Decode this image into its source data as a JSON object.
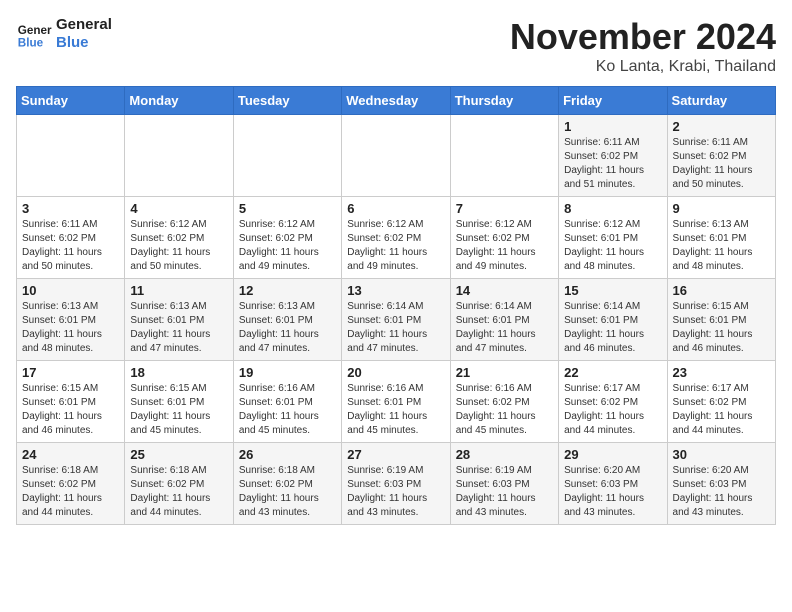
{
  "header": {
    "logo_line1": "General",
    "logo_line2": "Blue",
    "month": "November 2024",
    "location": "Ko Lanta, Krabi, Thailand"
  },
  "weekdays": [
    "Sunday",
    "Monday",
    "Tuesday",
    "Wednesday",
    "Thursday",
    "Friday",
    "Saturday"
  ],
  "weeks": [
    [
      {
        "day": "",
        "info": ""
      },
      {
        "day": "",
        "info": ""
      },
      {
        "day": "",
        "info": ""
      },
      {
        "day": "",
        "info": ""
      },
      {
        "day": "",
        "info": ""
      },
      {
        "day": "1",
        "info": "Sunrise: 6:11 AM\nSunset: 6:02 PM\nDaylight: 11 hours\nand 51 minutes."
      },
      {
        "day": "2",
        "info": "Sunrise: 6:11 AM\nSunset: 6:02 PM\nDaylight: 11 hours\nand 50 minutes."
      }
    ],
    [
      {
        "day": "3",
        "info": "Sunrise: 6:11 AM\nSunset: 6:02 PM\nDaylight: 11 hours\nand 50 minutes."
      },
      {
        "day": "4",
        "info": "Sunrise: 6:12 AM\nSunset: 6:02 PM\nDaylight: 11 hours\nand 50 minutes."
      },
      {
        "day": "5",
        "info": "Sunrise: 6:12 AM\nSunset: 6:02 PM\nDaylight: 11 hours\nand 49 minutes."
      },
      {
        "day": "6",
        "info": "Sunrise: 6:12 AM\nSunset: 6:02 PM\nDaylight: 11 hours\nand 49 minutes."
      },
      {
        "day": "7",
        "info": "Sunrise: 6:12 AM\nSunset: 6:02 PM\nDaylight: 11 hours\nand 49 minutes."
      },
      {
        "day": "8",
        "info": "Sunrise: 6:12 AM\nSunset: 6:01 PM\nDaylight: 11 hours\nand 48 minutes."
      },
      {
        "day": "9",
        "info": "Sunrise: 6:13 AM\nSunset: 6:01 PM\nDaylight: 11 hours\nand 48 minutes."
      }
    ],
    [
      {
        "day": "10",
        "info": "Sunrise: 6:13 AM\nSunset: 6:01 PM\nDaylight: 11 hours\nand 48 minutes."
      },
      {
        "day": "11",
        "info": "Sunrise: 6:13 AM\nSunset: 6:01 PM\nDaylight: 11 hours\nand 47 minutes."
      },
      {
        "day": "12",
        "info": "Sunrise: 6:13 AM\nSunset: 6:01 PM\nDaylight: 11 hours\nand 47 minutes."
      },
      {
        "day": "13",
        "info": "Sunrise: 6:14 AM\nSunset: 6:01 PM\nDaylight: 11 hours\nand 47 minutes."
      },
      {
        "day": "14",
        "info": "Sunrise: 6:14 AM\nSunset: 6:01 PM\nDaylight: 11 hours\nand 47 minutes."
      },
      {
        "day": "15",
        "info": "Sunrise: 6:14 AM\nSunset: 6:01 PM\nDaylight: 11 hours\nand 46 minutes."
      },
      {
        "day": "16",
        "info": "Sunrise: 6:15 AM\nSunset: 6:01 PM\nDaylight: 11 hours\nand 46 minutes."
      }
    ],
    [
      {
        "day": "17",
        "info": "Sunrise: 6:15 AM\nSunset: 6:01 PM\nDaylight: 11 hours\nand 46 minutes."
      },
      {
        "day": "18",
        "info": "Sunrise: 6:15 AM\nSunset: 6:01 PM\nDaylight: 11 hours\nand 45 minutes."
      },
      {
        "day": "19",
        "info": "Sunrise: 6:16 AM\nSunset: 6:01 PM\nDaylight: 11 hours\nand 45 minutes."
      },
      {
        "day": "20",
        "info": "Sunrise: 6:16 AM\nSunset: 6:01 PM\nDaylight: 11 hours\nand 45 minutes."
      },
      {
        "day": "21",
        "info": "Sunrise: 6:16 AM\nSunset: 6:02 PM\nDaylight: 11 hours\nand 45 minutes."
      },
      {
        "day": "22",
        "info": "Sunrise: 6:17 AM\nSunset: 6:02 PM\nDaylight: 11 hours\nand 44 minutes."
      },
      {
        "day": "23",
        "info": "Sunrise: 6:17 AM\nSunset: 6:02 PM\nDaylight: 11 hours\nand 44 minutes."
      }
    ],
    [
      {
        "day": "24",
        "info": "Sunrise: 6:18 AM\nSunset: 6:02 PM\nDaylight: 11 hours\nand 44 minutes."
      },
      {
        "day": "25",
        "info": "Sunrise: 6:18 AM\nSunset: 6:02 PM\nDaylight: 11 hours\nand 44 minutes."
      },
      {
        "day": "26",
        "info": "Sunrise: 6:18 AM\nSunset: 6:02 PM\nDaylight: 11 hours\nand 43 minutes."
      },
      {
        "day": "27",
        "info": "Sunrise: 6:19 AM\nSunset: 6:03 PM\nDaylight: 11 hours\nand 43 minutes."
      },
      {
        "day": "28",
        "info": "Sunrise: 6:19 AM\nSunset: 6:03 PM\nDaylight: 11 hours\nand 43 minutes."
      },
      {
        "day": "29",
        "info": "Sunrise: 6:20 AM\nSunset: 6:03 PM\nDaylight: 11 hours\nand 43 minutes."
      },
      {
        "day": "30",
        "info": "Sunrise: 6:20 AM\nSunset: 6:03 PM\nDaylight: 11 hours\nand 43 minutes."
      }
    ]
  ]
}
